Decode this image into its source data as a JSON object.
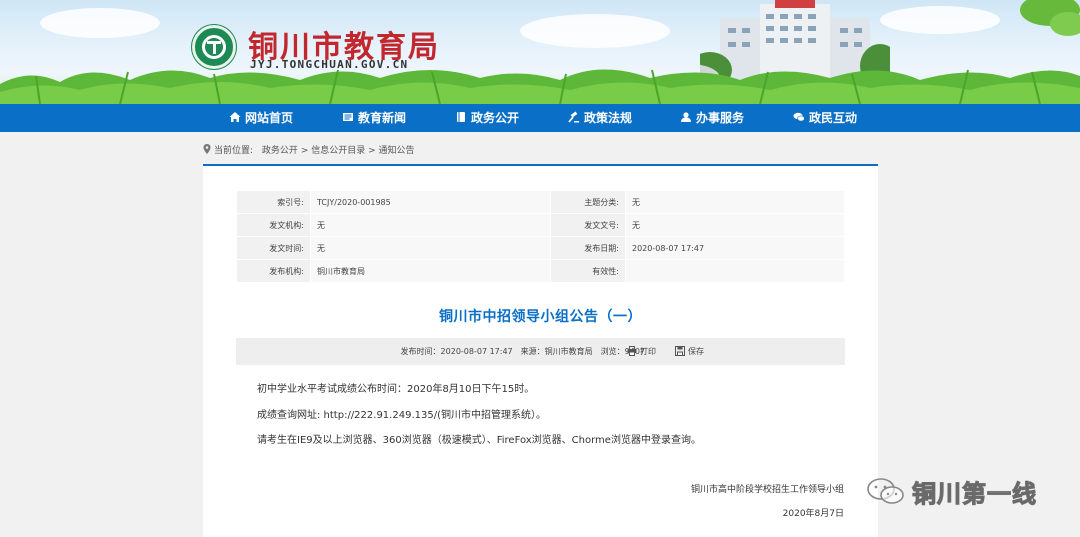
{
  "site": {
    "title": "铜川市教育局",
    "domain": "JYJ.TONGCHUAN.GOV.CN"
  },
  "nav": [
    {
      "label": "网站首页",
      "icon": "home-icon"
    },
    {
      "label": "教育新闻",
      "icon": "news-icon"
    },
    {
      "label": "政务公开",
      "icon": "book-icon"
    },
    {
      "label": "政策法规",
      "icon": "gavel-icon"
    },
    {
      "label": "办事服务",
      "icon": "user-icon"
    },
    {
      "label": "政民互动",
      "icon": "chat-icon"
    }
  ],
  "breadcrumb": {
    "prefix": "当前位置:",
    "items": [
      "政务公开",
      "信息公开目录",
      "通知公告"
    ],
    "sep": ">"
  },
  "meta": {
    "rows": [
      {
        "k1": "索引号:",
        "v1": "TCJY/2020-001985",
        "k2": "主题分类:",
        "v2": "无"
      },
      {
        "k1": "发文机构:",
        "v1": "无",
        "k2": "发文文号:",
        "v2": "无"
      },
      {
        "k1": "发文时间:",
        "v1": "无",
        "k2": "发布日期:",
        "v2": "2020-08-07 17:47"
      },
      {
        "k1": "发布机构:",
        "v1": "铜川市教育局",
        "k2": "有效性:",
        "v2": ""
      }
    ]
  },
  "article": {
    "title": "铜川市中招领导小组公告（一）",
    "info": "发布时间：2020-08-07 17:47　来源：铜川市教育局　浏览：9407",
    "print_label": "打印",
    "save_label": "保存",
    "paragraphs": [
      "初中学业水平考试成绩公布时间：2020年8月10日下午15时。",
      "成绩查询网址: http://222.91.249.135/(铜川市中招管理系统）。",
      "请考生在IE9及以上浏览器、360浏览器（极速模式）、FireFox浏览器、Chorme浏览器中登录查询。"
    ],
    "signature": "铜川市高中阶段学校招生工作领导小组",
    "date": "2020年8月7日"
  },
  "watermark": {
    "text": "铜川第一线"
  },
  "colors": {
    "brand_blue": "#0a6fc6",
    "title_red": "#c1272d",
    "logo_green": "#1d8a55"
  }
}
